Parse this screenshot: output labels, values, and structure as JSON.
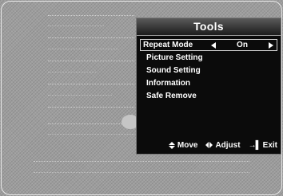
{
  "tools": {
    "title": "Tools",
    "items": [
      {
        "label": "Repeat Mode",
        "value": "On",
        "selected": true
      },
      {
        "label": "Picture Setting"
      },
      {
        "label": "Sound Setting"
      },
      {
        "label": "Information"
      },
      {
        "label": "Safe Remove"
      }
    ]
  },
  "footer": {
    "move_label": "Move",
    "adjust_label": "Adjust",
    "exit_label": "Exit",
    "exit_icon_glyph": "→▌"
  },
  "colors": {
    "panel_bg": "#0b0b0b",
    "text": "#ffffff",
    "screen_bg": "#9d9d9d"
  }
}
